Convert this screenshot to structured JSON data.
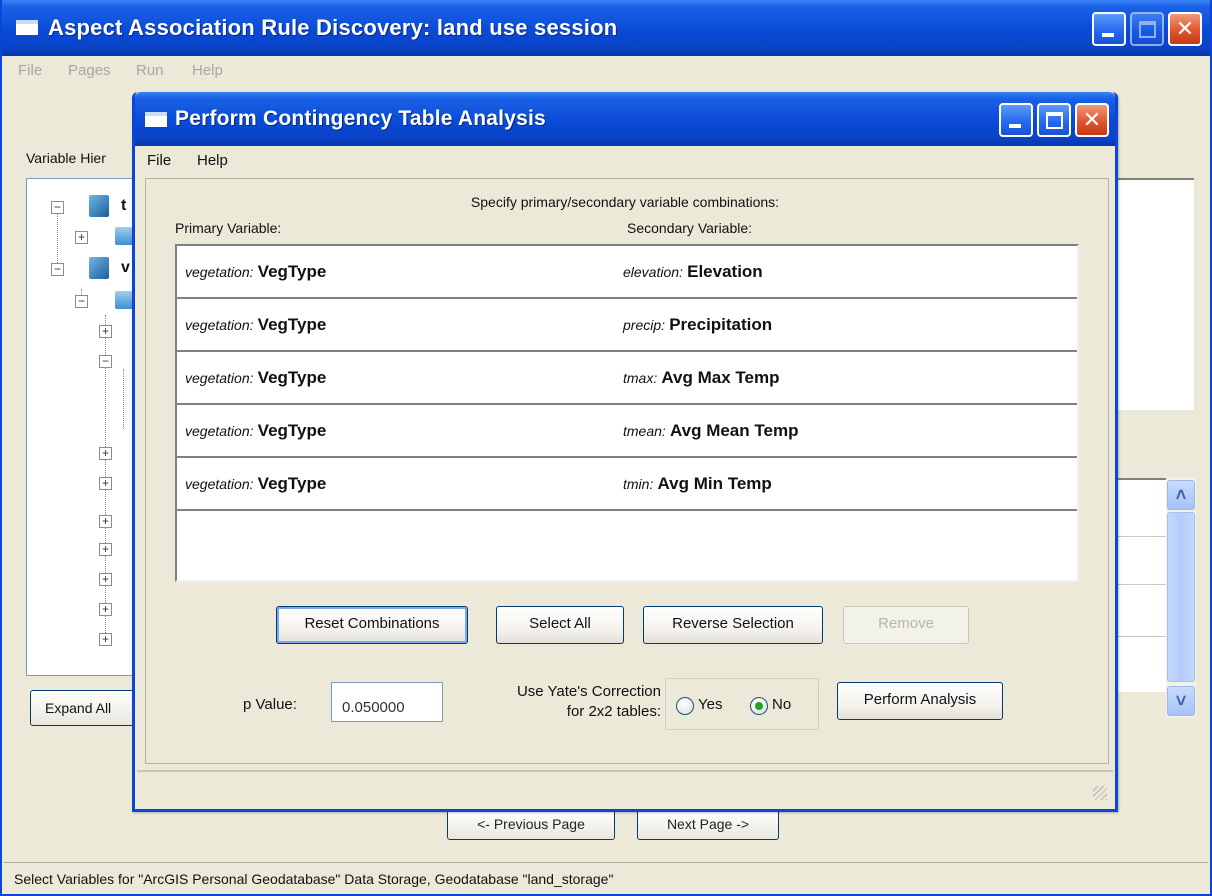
{
  "main_window": {
    "title": "Aspect Association Rule Discovery: land use session",
    "menu": [
      "File",
      "Pages",
      "Run",
      "Help"
    ],
    "variable_hierarchy_label": "Variable Hier",
    "tree_nodes": [
      "t",
      "v"
    ],
    "expand_all_label": "Expand All",
    "prev_page_label": "<- Previous Page",
    "next_page_label": "Next Page ->",
    "status": "Select Variables for \"ArcGIS Personal Geodatabase\" Data Storage, Geodatabase \"land_storage\""
  },
  "dialog": {
    "title": "Perform Contingency Table Analysis",
    "menu": [
      "File",
      "Help"
    ],
    "instructions": "Specify primary/secondary variable combinations:",
    "primary_header": "Primary Variable:",
    "secondary_header": "Secondary Variable:",
    "combinations": [
      {
        "primary_prefix": "vegetation:",
        "primary_var": "VegType",
        "secondary_prefix": "elevation:",
        "secondary_var": "Elevation"
      },
      {
        "primary_prefix": "vegetation:",
        "primary_var": "VegType",
        "secondary_prefix": "precip:",
        "secondary_var": "Precipitation"
      },
      {
        "primary_prefix": "vegetation:",
        "primary_var": "VegType",
        "secondary_prefix": "tmax:",
        "secondary_var": "Avg Max Temp"
      },
      {
        "primary_prefix": "vegetation:",
        "primary_var": "VegType",
        "secondary_prefix": "tmean:",
        "secondary_var": "Avg Mean Temp"
      },
      {
        "primary_prefix": "vegetation:",
        "primary_var": "VegType",
        "secondary_prefix": "tmin:",
        "secondary_var": "Avg Min Temp"
      }
    ],
    "buttons": {
      "reset": "Reset Combinations",
      "select_all": "Select All",
      "reverse": "Reverse Selection",
      "remove": "Remove",
      "perform": "Perform Analysis"
    },
    "p_value_label": "p Value:",
    "p_value": "0.050000",
    "yates_label_line1": "Use Yate's Correction",
    "yates_label_line2": "for 2x2 tables:",
    "yates_yes": "Yes",
    "yates_no": "No",
    "yates_selected": "No"
  },
  "colors": {
    "titlebar": "#0a4ad6",
    "close_button": "#e0552d",
    "window_face": "#ece9d8"
  }
}
